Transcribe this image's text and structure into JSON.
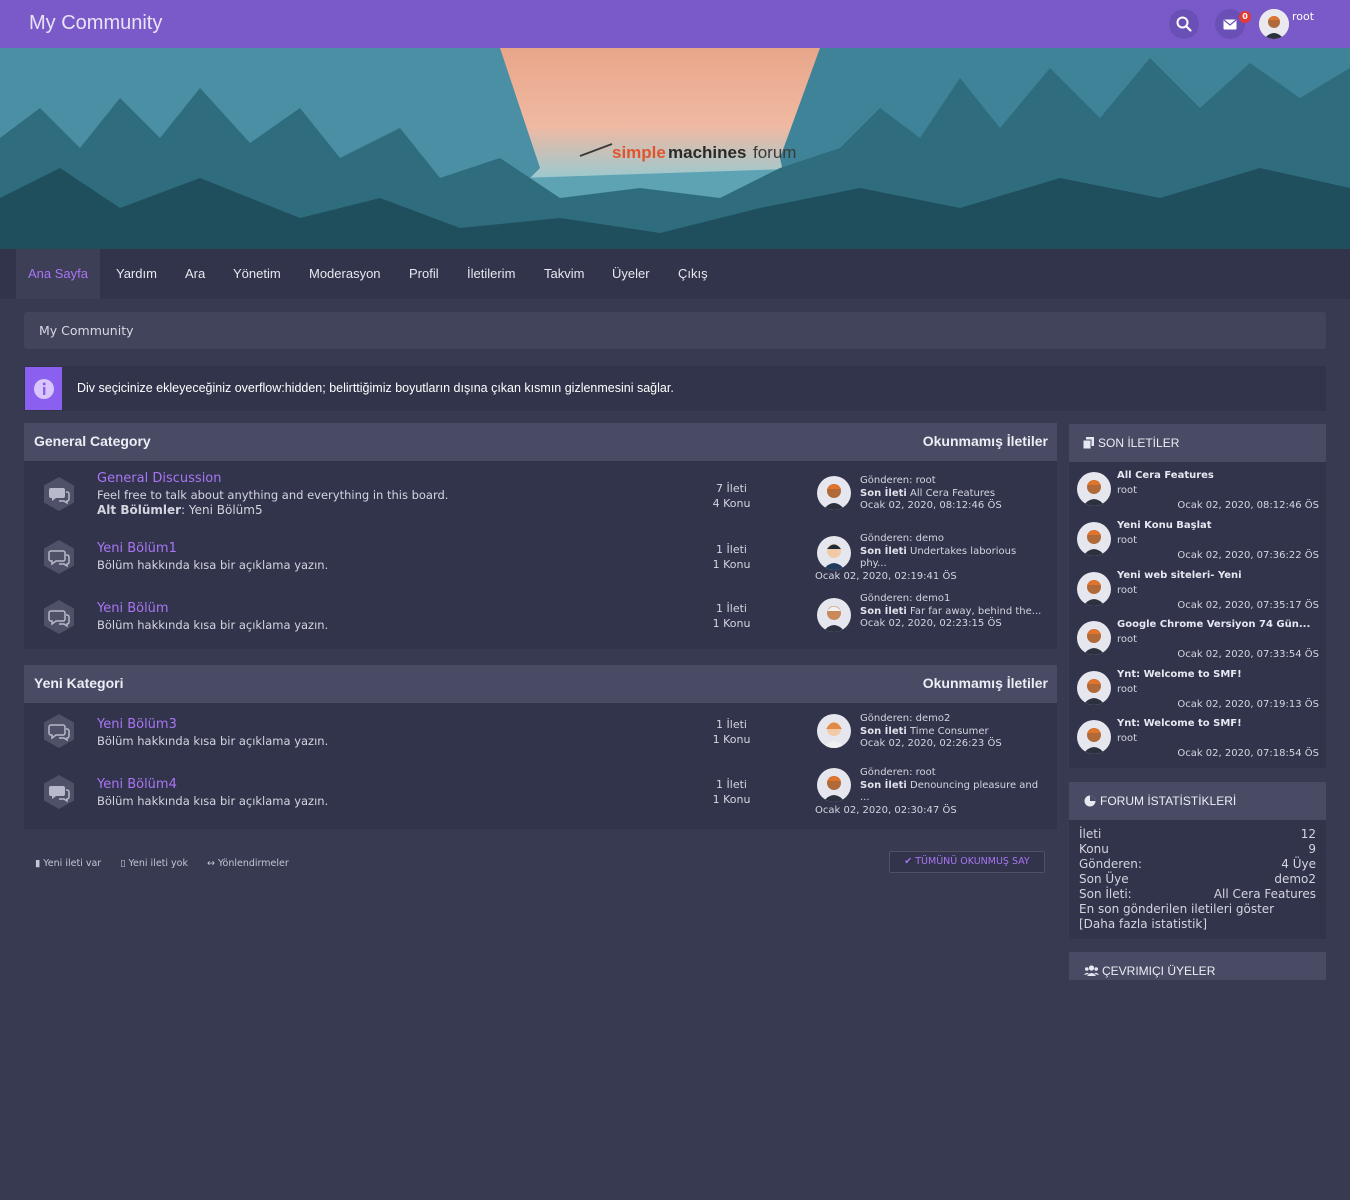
{
  "site": {
    "title": "My Community"
  },
  "header": {
    "badge_count": "0",
    "username": "root"
  },
  "banner": {
    "logo_left": "simple",
    "logo_mid": "machines",
    "logo_right": "forum"
  },
  "nav": {
    "items": [
      "Ana Sayfa",
      "Yardım",
      "Ara",
      "Yönetim",
      "Moderasyon",
      "Profil",
      "İletilerim",
      "Takvim",
      "Üyeler",
      "Çıkış"
    ]
  },
  "breadcrumb": {
    "label": "My Community"
  },
  "notice": {
    "text": "Div seçicinize ekleyeceğiniz overflow:hidden; belirttiğimiz boyutların dışına çıkan kısmın gizlenmesini sağlar."
  },
  "categories": [
    {
      "title": "General Category",
      "unread": "Okunmamış İletiler",
      "boards": [
        {
          "name": "General Discussion",
          "desc": "Feel free to talk about anything and everything in this board.",
          "sub_label": "Alt Bölümler",
          "sub_value": ": Yeni Bölüm5",
          "posts": "7 İleti",
          "topics": "4 Konu",
          "by": "Gönderen: root",
          "last_label": "Son İleti",
          "last": "All Cera Features",
          "date": "Ocak 02, 2020, 08:12:46 ÖS"
        },
        {
          "name": "Yeni Bölüm1",
          "desc": "Bölüm hakkında kısa bir açıklama yazın.",
          "posts": "1 İleti",
          "topics": "1 Konu",
          "by": "Gönderen: demo",
          "last_label": "Son İleti",
          "last": "Undertakes laborious",
          "last2": "phy...",
          "date": "Ocak 02, 2020, 02:19:41 ÖS"
        },
        {
          "name": "Yeni Bölüm",
          "desc": "Bölüm hakkında kısa bir açıklama yazın.",
          "posts": "1 İleti",
          "topics": "1 Konu",
          "by": "Gönderen: demo1",
          "last_label": "Son İleti",
          "last": "Far far away, behind the...",
          "date": "Ocak 02, 2020, 02:23:15 ÖS"
        }
      ]
    },
    {
      "title": "Yeni Kategori",
      "unread": "Okunmamış İletiler",
      "boards": [
        {
          "name": "Yeni Bölüm3",
          "desc": "Bölüm hakkında kısa bir açıklama yazın.",
          "posts": "1 İleti",
          "topics": "1 Konu",
          "by": "Gönderen: demo2",
          "last_label": "Son İleti",
          "last": "Time Consumer",
          "date": "Ocak 02, 2020, 02:26:23 ÖS"
        },
        {
          "name": "Yeni Bölüm4",
          "desc": "Bölüm hakkında kısa bir açıklama yazın.",
          "posts": "1 İleti",
          "topics": "1 Konu",
          "by": "Gönderen: root",
          "last_label": "Son İleti",
          "last": "Denouncing pleasure and",
          "last2": "...",
          "date": "Ocak 02, 2020, 02:30:47 ÖS"
        }
      ]
    }
  ],
  "legend": {
    "new": "Yeni ileti var",
    "none": "Yeni ileti yok",
    "redirect": "Yönlendirmeler"
  },
  "mark_read": "TÜMÜNÜ OKUNMUŞ SAY",
  "recent": {
    "title": "SON İLETİLER",
    "posts": [
      {
        "title": "All Cera Features",
        "user": "root",
        "date": "Ocak 02, 2020, 08:12:46 ÖS"
      },
      {
        "title": "Yeni Konu Başlat",
        "user": "root",
        "date": "Ocak 02, 2020, 07:36:22 ÖS"
      },
      {
        "title": "Yeni web siteleri- Yeni",
        "user": "root",
        "date": "Ocak 02, 2020, 07:35:17 ÖS"
      },
      {
        "title": "Google Chrome Versiyon 74 Gün...",
        "user": "root",
        "date": "Ocak 02, 2020, 07:33:54 ÖS"
      },
      {
        "title": "Ynt: Welcome to SMF!",
        "user": "root",
        "date": "Ocak 02, 2020, 07:19:13 ÖS"
      },
      {
        "title": "Ynt: Welcome to SMF!",
        "user": "root",
        "date": "Ocak 02, 2020, 07:18:54 ÖS"
      }
    ]
  },
  "stats": {
    "title": "FORUM İSTATİSTİKLERİ",
    "rows": [
      {
        "label": "İleti",
        "value": "12"
      },
      {
        "label": "Konu",
        "value": "9"
      },
      {
        "label": "Gönderen:",
        "value": "4 Üye"
      },
      {
        "label": "Son Üye",
        "value": "demo2"
      },
      {
        "label": "Son İleti:",
        "value": "All Cera Features"
      }
    ],
    "recent_link": "En son gönderilen iletileri göster",
    "more_link": "[Daha fazla istatistik]"
  },
  "online": {
    "title": "ÇEVRIMIÇI ÜYELER"
  },
  "colors": {
    "accent": "#7a5ac8",
    "link": "#a975f5",
    "bg": "#373a51",
    "panel": "#31344a",
    "header": "#484b63"
  }
}
